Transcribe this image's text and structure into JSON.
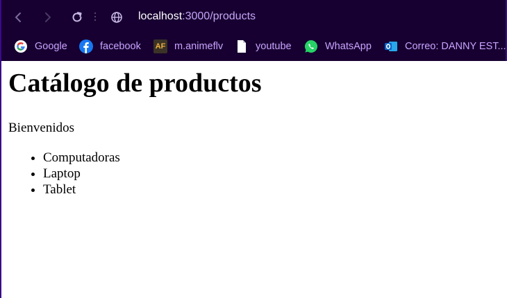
{
  "browser": {
    "url_host": "localhost",
    "url_path": ":3000/products",
    "bookmarks": [
      {
        "label": "Google",
        "icon": "google-icon"
      },
      {
        "label": "facebook",
        "icon": "facebook-icon"
      },
      {
        "label": "m.animeflv",
        "icon": "animeflv-icon"
      },
      {
        "label": "youtube",
        "icon": "document-icon"
      },
      {
        "label": "WhatsApp",
        "icon": "whatsapp-icon"
      },
      {
        "label": "Correo: DANNY EST...",
        "icon": "outlook-icon"
      }
    ],
    "colors": {
      "frame": "#170031",
      "bookmark_text": "#c9a4ff",
      "url_path": "#c6a6f6"
    }
  },
  "page": {
    "title": "Catálogo de productos",
    "welcome": "Bienvenidos",
    "products": [
      "Computadoras",
      "Laptop",
      "Tablet"
    ]
  }
}
